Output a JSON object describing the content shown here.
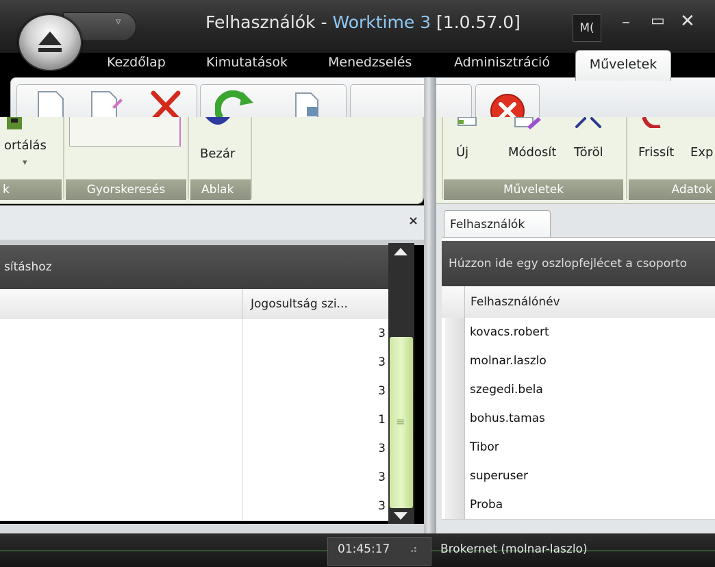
{
  "window": {
    "title_prefix": "Felhasználók - ",
    "app_name": "Worktime 3",
    "version": "[1.0.57.0]",
    "user_initials": "M(",
    "min_glyph": "–",
    "max_glyph": "▭",
    "close_glyph": "✕"
  },
  "qat": {
    "dropdown_glyph": "▿"
  },
  "ribbon": {
    "tabs": [
      "Kezdőlap",
      "Kimutatások",
      "Menedzselés",
      "Adminisztráció",
      "Műveletek"
    ],
    "active_tab": "Műveletek"
  },
  "left_ribbon": {
    "sort_label": "ortálás",
    "sort_dropdown": "▾",
    "group_cut_caption": "k",
    "quicksearch_caption": "Gyorskeresés",
    "close_label": "Bezár",
    "window_caption": "Ablak"
  },
  "right_ribbon": {
    "new_label": "Új",
    "edit_label": "Módosít",
    "delete_label": "Töröl",
    "refresh_label": "Frissít",
    "export_label": "Exp",
    "actions_caption": "Műveletek",
    "data_caption": "Adatok"
  },
  "left_panel": {
    "close_glyph": "×",
    "group_hint": "sításhoz",
    "column_header": "Jogosultság szi...",
    "values": [
      "3",
      "3",
      "3",
      "1",
      "3",
      "3",
      "3"
    ]
  },
  "right_panel": {
    "tab_label": "Felhasználók",
    "group_hint": "Húzzon ide egy oszlopfejlécet a csoporto",
    "column_header": "Felhasználónév",
    "users": [
      "kovacs.robert",
      "molnar.laszlo",
      "szegedi.bela",
      "bohus.tamas",
      "Tibor",
      "superuser",
      "Proba"
    ]
  },
  "statusbar": {
    "time": "01:45:17",
    "connection": "Brokernet (molnar-laszlo)"
  },
  "colors": {
    "title_bar": "#262626",
    "app_name": "#8fc8f5",
    "ribbon_body": "#eff3e6",
    "group_caption": "#8d9282",
    "scroll_thumb": "#d4ecb0",
    "status_line": "#4aa54a"
  },
  "icons": [
    "orb-eject-icon",
    "new-document-icon",
    "edit-document-icon",
    "delete-x-icon",
    "refresh-icon",
    "export-document-icon",
    "close-red-icon",
    "resize-grip-icon"
  ]
}
